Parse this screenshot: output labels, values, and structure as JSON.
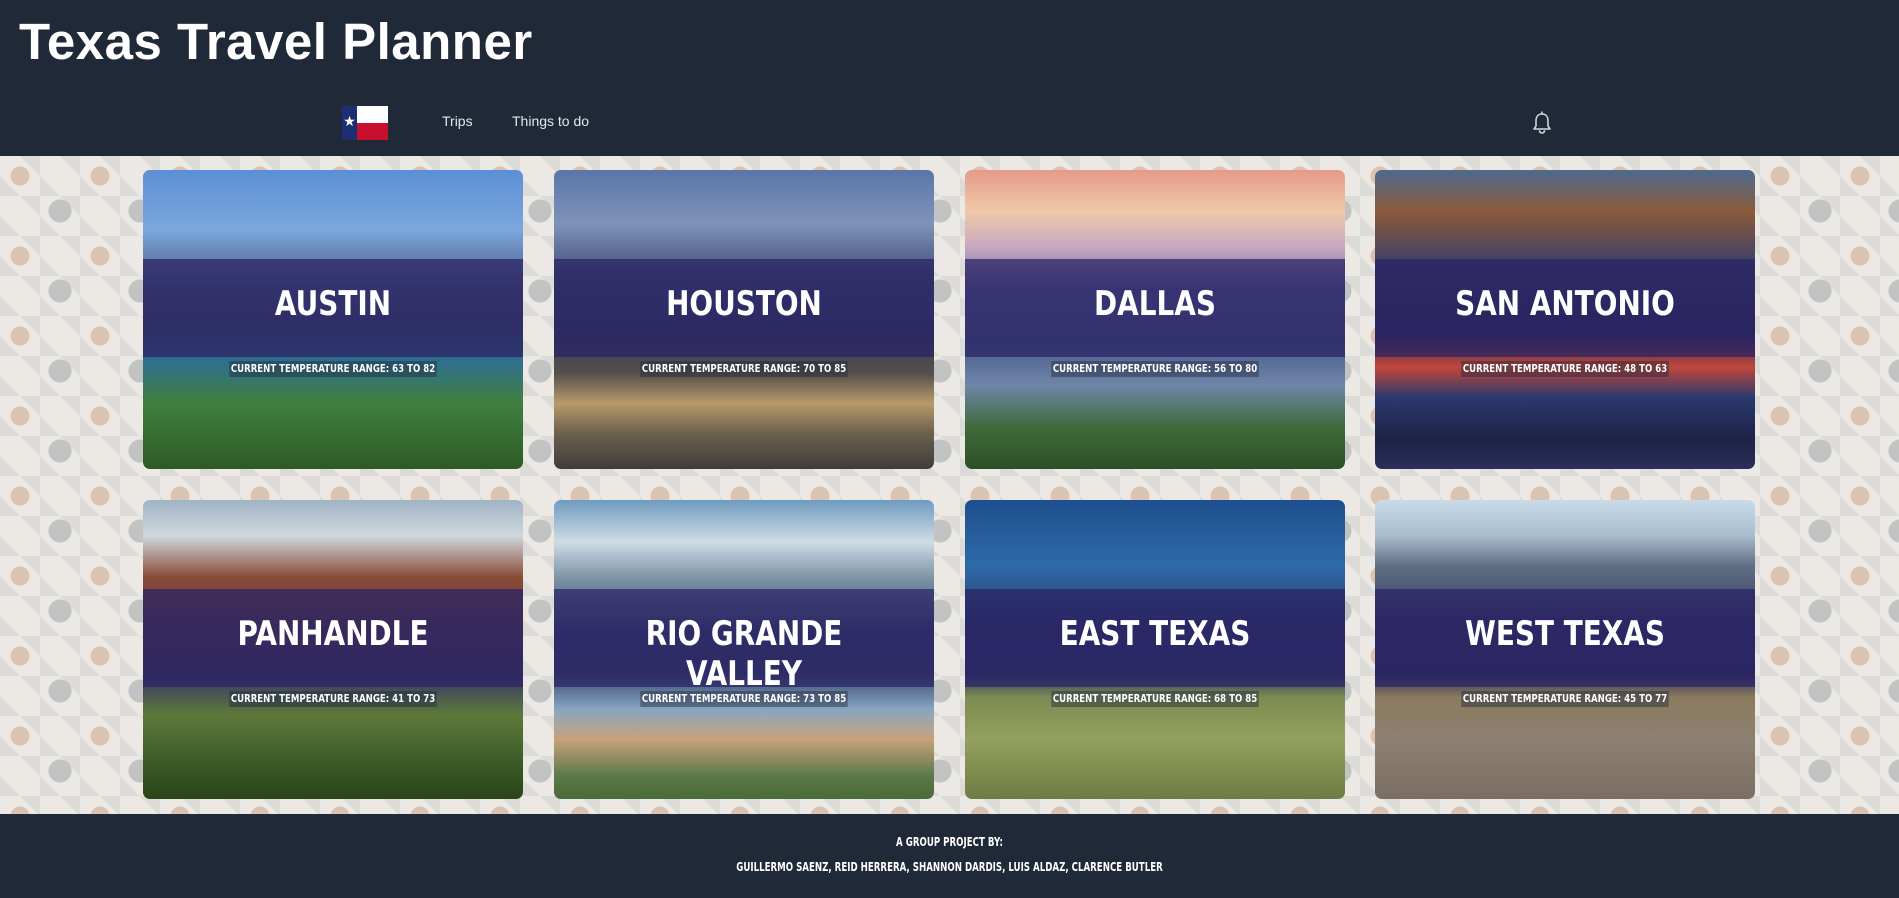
{
  "app": {
    "title": "Texas Travel Planner"
  },
  "nav": {
    "flag_icon": "texas-flag-icon",
    "links": [
      {
        "label": "Trips"
      },
      {
        "label": "Things to do"
      }
    ],
    "notification_icon": "bell-icon"
  },
  "destinations": [
    {
      "name": "AUSTIN",
      "temperature": "CURRENT TEMPERATURE RANGE: 63 TO 82"
    },
    {
      "name": "HOUSTON",
      "temperature": "CURRENT TEMPERATURE RANGE: 70 TO 85"
    },
    {
      "name": "DALLAS",
      "temperature": "CURRENT TEMPERATURE RANGE: 56 TO 80"
    },
    {
      "name": "SAN ANTONIO",
      "temperature": "CURRENT TEMPERATURE RANGE: 48 TO 63"
    },
    {
      "name": "PANHANDLE",
      "temperature": "CURRENT TEMPERATURE RANGE: 41 TO 73"
    },
    {
      "name": "RIO GRANDE VALLEY",
      "temperature": "CURRENT TEMPERATURE RANGE: 73 TO 85"
    },
    {
      "name": "EAST TEXAS",
      "temperature": "CURRENT TEMPERATURE RANGE: 68 TO 85"
    },
    {
      "name": "WEST TEXAS",
      "temperature": "CURRENT TEMPERATURE RANGE: 45 TO 77"
    }
  ],
  "footer": {
    "heading": "A GROUP PROJECT BY:",
    "members": "GUILLERMO SAENZ, REID HERRERA, SHANNON DARDIS, LUIS ALDAZ, CLARENCE BUTLER"
  },
  "colors": {
    "header_bg": "#1f2937",
    "overlay_band": "#2a2364",
    "flag_blue": "#1c2f72",
    "flag_red": "#c8102e"
  }
}
